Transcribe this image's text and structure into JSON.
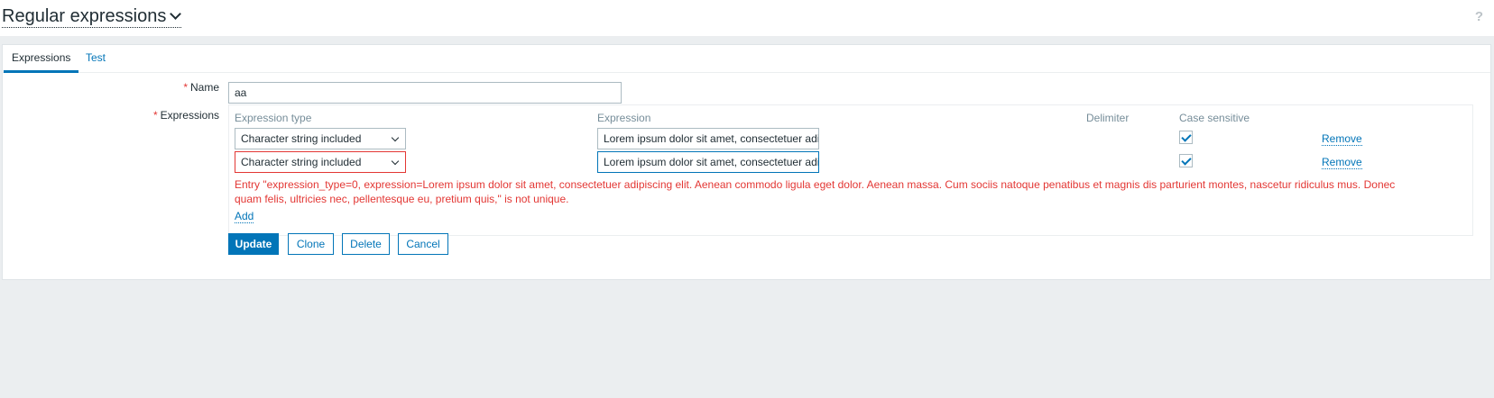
{
  "header": {
    "title": "Regular expressions",
    "help_glyph": "?"
  },
  "tabs": [
    {
      "label": "Expressions",
      "active": true
    },
    {
      "label": "Test",
      "active": false
    }
  ],
  "form": {
    "name_label": "Name",
    "name_value": "aa",
    "expressions_label": "Expressions",
    "required_mark": "*"
  },
  "expressions": {
    "columns": {
      "type": "Expression type",
      "expression": "Expression",
      "delimiter": "Delimiter",
      "case_sensitive": "Case sensitive"
    },
    "rows": [
      {
        "type": "Character string included",
        "expression": "Lorem ipsum dolor sit amet, consectetuer adipiscing elit. Aenean commodo ligula eget dolor. Aenean massa. Cum sociis natoque penatibus et magnis dis parturient montes, nascetur ridiculus mus. Donec quam felis, ultricies nec, pellentesque eu, pretium quis,",
        "case_sensitive": true,
        "remove_label": "Remove"
      },
      {
        "type": "Character string included",
        "expression": "Lorem ipsum dolor sit amet, consectetuer adipiscing elit. Aenean commodo ligula eget dolor. Aenean massa. Cum sociis natoque penatibus et magnis dis parturient montes, nascetur ridiculus mus. Donec quam felis, ultricies nec, pellentesque eu, pretium quis,",
        "case_sensitive": true,
        "remove_label": "Remove"
      }
    ],
    "error": "Entry \"expression_type=0, expression=Lorem ipsum dolor sit amet, consectetuer adipiscing elit. Aenean commodo ligula eget dolor. Aenean massa. Cum sociis natoque penatibus et magnis dis parturient montes, nascetur ridiculus mus. Donec quam felis, ultricies nec, pellentesque eu, pretium quis,\" is not unique.",
    "add_label": "Add"
  },
  "buttons": {
    "update": "Update",
    "clone": "Clone",
    "delete": "Delete",
    "cancel": "Cancel"
  },
  "colors": {
    "accent": "#0275b8",
    "error": "#e33734",
    "background": "#ebeef0"
  }
}
